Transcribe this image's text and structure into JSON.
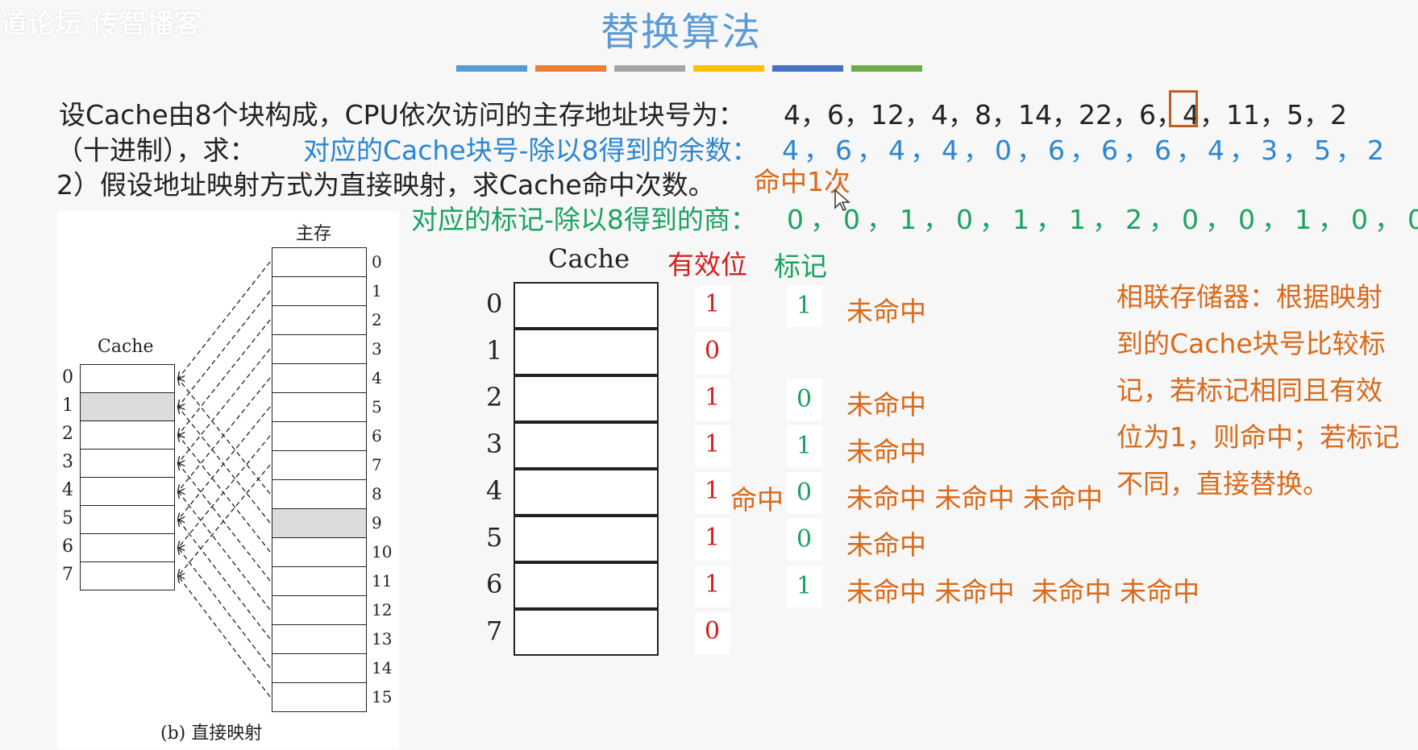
{
  "watermark": "道论坛 传智播客",
  "title": "替换算法",
  "accent_bars": [
    "#5b9bd5",
    "#ed7d31",
    "#a5a5a5",
    "#ffc000",
    "#4472c4",
    "#70ad47"
  ],
  "problem": {
    "line1_prefix": "设Cache由8个块构成，CPU依次访问的主存地址块号为：",
    "sequence": [
      "4",
      "6",
      "12",
      "4",
      "8",
      "14",
      "22",
      "6",
      "4",
      "11",
      "5",
      "2"
    ],
    "line2_prefix": "（十进制），求：",
    "cache_block_label": "对应的Cache块号-除以8得到的余数：",
    "remainders": [
      "4",
      "6",
      "4",
      "4",
      "0",
      "6",
      "6",
      "6",
      "4",
      "3",
      "5",
      "2"
    ],
    "line3": "2）假设地址映射方式为直接映射，求Cache命中次数。",
    "hit_count_note": "命中1次",
    "tag_label": "对应的标记-除以8得到的商：",
    "quotients": [
      "0",
      "0",
      "1",
      "0",
      "1",
      "1",
      "2",
      "0",
      "0",
      "1",
      "0",
      "0"
    ]
  },
  "figure": {
    "main_memory_label": "主存",
    "cache_label": "Cache",
    "caption": "(b) 直接映射",
    "cache_rows": [
      "0",
      "1",
      "2",
      "3",
      "4",
      "5",
      "6",
      "7"
    ],
    "memory_rows": [
      "0",
      "1",
      "2",
      "3",
      "4",
      "5",
      "6",
      "7",
      "8",
      "9",
      "10",
      "11",
      "12",
      "13",
      "14",
      "15"
    ]
  },
  "cache_table": {
    "header_cache": "Cache",
    "header_valid": "有效位",
    "header_tag": "标记",
    "rows": [
      {
        "index": "0",
        "valid": "1",
        "tag": "1",
        "status": "未命中"
      },
      {
        "index": "1",
        "valid": "0",
        "tag": "",
        "status": ""
      },
      {
        "index": "2",
        "valid": "1",
        "tag": "0",
        "status": "未命中"
      },
      {
        "index": "3",
        "valid": "1",
        "tag": "1",
        "status": "未命中"
      },
      {
        "index": "4",
        "valid": "1",
        "tag": "0",
        "status": "未命中 未命中 未命中",
        "hit": "命中"
      },
      {
        "index": "5",
        "valid": "1",
        "tag": "0",
        "status": "未命中"
      },
      {
        "index": "6",
        "valid": "1",
        "tag": "1",
        "status": "未命中 未命中  未命中 未命中"
      },
      {
        "index": "7",
        "valid": "0",
        "tag": "",
        "status": ""
      }
    ]
  },
  "note": "相联存储器：根据映射到的Cache块号比较标记，若标记相同且有效位为1，则命中；若标记不同，直接替换。"
}
